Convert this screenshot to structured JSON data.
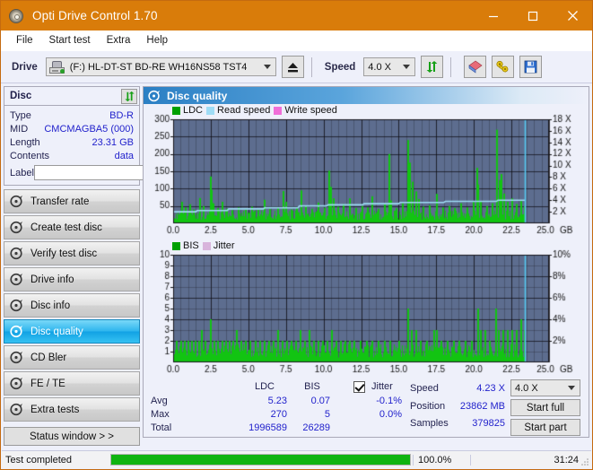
{
  "window": {
    "title": "Opti Drive Control 1.70",
    "icon": "disc-icon",
    "minimize": "–",
    "maximize": "□",
    "close": "✕"
  },
  "menu": {
    "items": [
      "File",
      "Start test",
      "Extra",
      "Help"
    ]
  },
  "toolbar": {
    "drive_label": "Drive",
    "drive_value": "(F:)  HL-DT-ST BD-RE  WH16NS58 TST4",
    "eject_icon": "eject-icon",
    "speed_label": "Speed",
    "speed_value": "4.0 X",
    "refresh_icon": "refresh-icon",
    "erase_icon": "erase-icon",
    "tools_icon": "tools-icon",
    "save_icon": "save-icon"
  },
  "disc_panel": {
    "title": "Disc",
    "refresh_icon": "refresh-icon",
    "rows": [
      {
        "key": "Type",
        "value": "BD-R"
      },
      {
        "key": "MID",
        "value": "CMCMAGBA5 (000)"
      },
      {
        "key": "Length",
        "value": "23.31 GB"
      },
      {
        "key": "Contents",
        "value": "data"
      }
    ],
    "label_key": "Label",
    "label_value": "",
    "label_placeholder": "",
    "label_button_icon": "cd-icon"
  },
  "sidebar": {
    "items": [
      {
        "label": "Transfer rate",
        "icon": "disc-icon",
        "active": false
      },
      {
        "label": "Create test disc",
        "icon": "disc-icon",
        "active": false
      },
      {
        "label": "Verify test disc",
        "icon": "disc-icon",
        "active": false
      },
      {
        "label": "Drive info",
        "icon": "disc-icon",
        "active": false
      },
      {
        "label": "Disc info",
        "icon": "disc-icon",
        "active": false
      },
      {
        "label": "Disc quality",
        "icon": "disc-icon",
        "active": true
      },
      {
        "label": "CD Bler",
        "icon": "disc-icon",
        "active": false
      },
      {
        "label": "FE / TE",
        "icon": "disc-icon",
        "active": false
      },
      {
        "label": "Extra tests",
        "icon": "disc-icon",
        "active": false
      }
    ],
    "status_window_button": "Status window > >"
  },
  "main": {
    "header": "Disc quality",
    "header_icon": "disc-icon"
  },
  "chart_data": [
    {
      "type": "line",
      "name": "top-chart",
      "title": "Disc quality - LDC / speed",
      "xlabel": "GB",
      "ylabel": "",
      "xlim": [
        0,
        25
      ],
      "ylim": [
        0,
        300
      ],
      "y2lim": [
        0,
        18
      ],
      "xticks": [
        "0.0",
        "2.5",
        "5.0",
        "7.5",
        "10.0",
        "12.5",
        "15.0",
        "17.5",
        "20.0",
        "22.5",
        "25.0"
      ],
      "yticks": [
        "50",
        "100",
        "150",
        "200",
        "250",
        "300"
      ],
      "y2ticks": [
        "2 X",
        "4 X",
        "6 X",
        "8 X",
        "10 X",
        "12 X",
        "14 X",
        "16 X",
        "18 X"
      ],
      "x_unit": "GB",
      "grid": true,
      "legend": [
        {
          "label": "LDC",
          "color": "#00a000"
        },
        {
          "label": "Read speed",
          "color": "#9fdcf5"
        },
        {
          "label": "Write speed",
          "color": "#f06fd8"
        }
      ],
      "data_end_gb": 23.4,
      "plot_bg": "#5d6d8f",
      "series": [
        {
          "name": "LDC",
          "color": "#12c412",
          "type": "impulse",
          "baseline": 22,
          "peaks": [
            {
              "x": 0.55,
              "y": 62
            },
            {
              "x": 0.8,
              "y": 46
            },
            {
              "x": 1.05,
              "y": 55
            },
            {
              "x": 1.3,
              "y": 40
            },
            {
              "x": 1.75,
              "y": 73
            },
            {
              "x": 1.95,
              "y": 50
            },
            {
              "x": 2.45,
              "y": 135
            },
            {
              "x": 2.5,
              "y": 96
            },
            {
              "x": 2.62,
              "y": 58
            },
            {
              "x": 2.9,
              "y": 44
            },
            {
              "x": 3.2,
              "y": 62
            },
            {
              "x": 3.5,
              "y": 42
            },
            {
              "x": 3.9,
              "y": 38
            },
            {
              "x": 4.3,
              "y": 46
            },
            {
              "x": 4.8,
              "y": 40
            },
            {
              "x": 5.2,
              "y": 48
            },
            {
              "x": 5.6,
              "y": 39
            },
            {
              "x": 6.0,
              "y": 68
            },
            {
              "x": 6.4,
              "y": 41
            },
            {
              "x": 6.9,
              "y": 44
            },
            {
              "x": 7.3,
              "y": 93
            },
            {
              "x": 7.45,
              "y": 62
            },
            {
              "x": 7.8,
              "y": 40
            },
            {
              "x": 8.2,
              "y": 46
            },
            {
              "x": 8.5,
              "y": 95
            },
            {
              "x": 8.8,
              "y": 52
            },
            {
              "x": 9.2,
              "y": 42
            },
            {
              "x": 9.6,
              "y": 60
            },
            {
              "x": 10.0,
              "y": 45
            },
            {
              "x": 10.3,
              "y": 152
            },
            {
              "x": 10.45,
              "y": 105
            },
            {
              "x": 10.6,
              "y": 72
            },
            {
              "x": 10.9,
              "y": 48
            },
            {
              "x": 11.3,
              "y": 56
            },
            {
              "x": 11.7,
              "y": 72
            },
            {
              "x": 12.1,
              "y": 44
            },
            {
              "x": 12.5,
              "y": 50
            },
            {
              "x": 12.9,
              "y": 46
            },
            {
              "x": 13.2,
              "y": 78
            },
            {
              "x": 13.6,
              "y": 42
            },
            {
              "x": 14.0,
              "y": 55
            },
            {
              "x": 14.3,
              "y": 200
            },
            {
              "x": 14.45,
              "y": 66
            },
            {
              "x": 14.8,
              "y": 44
            },
            {
              "x": 15.2,
              "y": 58
            },
            {
              "x": 15.6,
              "y": 240
            },
            {
              "x": 15.7,
              "y": 175
            },
            {
              "x": 15.85,
              "y": 120
            },
            {
              "x": 16.1,
              "y": 92
            },
            {
              "x": 16.3,
              "y": 70
            },
            {
              "x": 16.6,
              "y": 48
            },
            {
              "x": 17.0,
              "y": 52
            },
            {
              "x": 17.5,
              "y": 85
            },
            {
              "x": 17.9,
              "y": 46
            },
            {
              "x": 18.3,
              "y": 50
            },
            {
              "x": 18.7,
              "y": 44
            },
            {
              "x": 19.1,
              "y": 58
            },
            {
              "x": 19.5,
              "y": 46
            },
            {
              "x": 19.9,
              "y": 62
            },
            {
              "x": 20.15,
              "y": 160
            },
            {
              "x": 20.25,
              "y": 112
            },
            {
              "x": 20.4,
              "y": 64
            },
            {
              "x": 20.8,
              "y": 50
            },
            {
              "x": 21.2,
              "y": 58
            },
            {
              "x": 21.5,
              "y": 270
            },
            {
              "x": 21.65,
              "y": 125
            },
            {
              "x": 21.8,
              "y": 142
            },
            {
              "x": 21.95,
              "y": 86
            },
            {
              "x": 22.2,
              "y": 62
            },
            {
              "x": 22.5,
              "y": 72
            },
            {
              "x": 22.8,
              "y": 56
            },
            {
              "x": 23.1,
              "y": 64
            },
            {
              "x": 23.3,
              "y": 50
            }
          ]
        },
        {
          "name": "Read speed",
          "color": "#9fdcf5",
          "type": "step",
          "points": [
            {
              "x": 0.0,
              "y": 2.0
            },
            {
              "x": 1.5,
              "y": 2.0
            },
            {
              "x": 1.6,
              "y": 2.2
            },
            {
              "x": 3.6,
              "y": 2.2
            },
            {
              "x": 3.7,
              "y": 2.5
            },
            {
              "x": 6.0,
              "y": 2.5
            },
            {
              "x": 6.1,
              "y": 2.7
            },
            {
              "x": 8.3,
              "y": 2.7
            },
            {
              "x": 8.4,
              "y": 3.0
            },
            {
              "x": 10.2,
              "y": 3.0
            },
            {
              "x": 10.3,
              "y": 3.2
            },
            {
              "x": 12.6,
              "y": 3.2
            },
            {
              "x": 12.7,
              "y": 3.4
            },
            {
              "x": 15.0,
              "y": 3.4
            },
            {
              "x": 15.1,
              "y": 3.6
            },
            {
              "x": 18.0,
              "y": 3.6
            },
            {
              "x": 18.1,
              "y": 3.8
            },
            {
              "x": 21.5,
              "y": 3.8
            },
            {
              "x": 21.6,
              "y": 4.0
            },
            {
              "x": 23.4,
              "y": 4.0
            }
          ]
        },
        {
          "name": "Cursor",
          "color": "#55c8f0",
          "type": "vline",
          "x": 23.4
        }
      ]
    },
    {
      "type": "line",
      "name": "bottom-chart",
      "title": "Disc quality - BIS / jitter",
      "xlabel": "GB",
      "ylabel": "",
      "xlim": [
        0,
        25
      ],
      "ylim": [
        0,
        10
      ],
      "y2lim": [
        0,
        10
      ],
      "xticks": [
        "0.0",
        "2.5",
        "5.0",
        "7.5",
        "10.0",
        "12.5",
        "15.0",
        "17.5",
        "20.0",
        "22.5",
        "25.0"
      ],
      "yticks": [
        "1",
        "2",
        "3",
        "4",
        "5",
        "6",
        "7",
        "8",
        "9",
        "10"
      ],
      "y2ticks": [
        "2%",
        "4%",
        "6%",
        "8%",
        "10%"
      ],
      "x_unit": "GB",
      "grid": true,
      "legend": [
        {
          "label": "BIS",
          "color": "#00a000"
        },
        {
          "label": "Jitter",
          "color": "#d8b4dc"
        }
      ],
      "data_end_gb": 23.4,
      "plot_bg": "#5d6d8f",
      "series": [
        {
          "name": "BIS",
          "color": "#12c412",
          "type": "impulse",
          "baseline": 1.0,
          "peaks": [
            {
              "x": 0.2,
              "y": 2
            },
            {
              "x": 0.45,
              "y": 2
            },
            {
              "x": 0.7,
              "y": 2
            },
            {
              "x": 0.95,
              "y": 2
            },
            {
              "x": 1.2,
              "y": 2
            },
            {
              "x": 1.45,
              "y": 2
            },
            {
              "x": 1.7,
              "y": 2
            },
            {
              "x": 1.85,
              "y": 3
            },
            {
              "x": 2.1,
              "y": 2
            },
            {
              "x": 2.45,
              "y": 4
            },
            {
              "x": 2.7,
              "y": 2
            },
            {
              "x": 2.95,
              "y": 2
            },
            {
              "x": 3.2,
              "y": 2
            },
            {
              "x": 3.45,
              "y": 2
            },
            {
              "x": 3.7,
              "y": 2
            },
            {
              "x": 3.95,
              "y": 2
            },
            {
              "x": 4.2,
              "y": 3
            },
            {
              "x": 4.5,
              "y": 2
            },
            {
              "x": 4.8,
              "y": 2
            },
            {
              "x": 5.1,
              "y": 2
            },
            {
              "x": 5.4,
              "y": 2
            },
            {
              "x": 5.7,
              "y": 2
            },
            {
              "x": 6.0,
              "y": 2
            },
            {
              "x": 6.3,
              "y": 2
            },
            {
              "x": 6.6,
              "y": 2
            },
            {
              "x": 6.9,
              "y": 3
            },
            {
              "x": 7.2,
              "y": 2
            },
            {
              "x": 7.5,
              "y": 2
            },
            {
              "x": 7.8,
              "y": 2
            },
            {
              "x": 8.1,
              "y": 2
            },
            {
              "x": 8.4,
              "y": 3
            },
            {
              "x": 8.7,
              "y": 2
            },
            {
              "x": 9.0,
              "y": 3
            },
            {
              "x": 9.3,
              "y": 2
            },
            {
              "x": 9.6,
              "y": 2
            },
            {
              "x": 9.9,
              "y": 2
            },
            {
              "x": 10.2,
              "y": 2
            },
            {
              "x": 10.5,
              "y": 3
            },
            {
              "x": 10.8,
              "y": 2
            },
            {
              "x": 11.1,
              "y": 2
            },
            {
              "x": 11.4,
              "y": 2
            },
            {
              "x": 11.7,
              "y": 2
            },
            {
              "x": 12.0,
              "y": 2
            },
            {
              "x": 12.4,
              "y": 2
            },
            {
              "x": 12.8,
              "y": 2
            },
            {
              "x": 13.2,
              "y": 2
            },
            {
              "x": 13.6,
              "y": 2
            },
            {
              "x": 14.0,
              "y": 2
            },
            {
              "x": 14.4,
              "y": 2
            },
            {
              "x": 15.0,
              "y": 2
            },
            {
              "x": 15.6,
              "y": 5
            },
            {
              "x": 15.8,
              "y": 3
            },
            {
              "x": 16.1,
              "y": 3
            },
            {
              "x": 16.4,
              "y": 2
            },
            {
              "x": 16.8,
              "y": 2
            },
            {
              "x": 17.3,
              "y": 3
            },
            {
              "x": 17.5,
              "y": 3
            },
            {
              "x": 17.8,
              "y": 2
            },
            {
              "x": 18.2,
              "y": 2
            },
            {
              "x": 18.6,
              "y": 2
            },
            {
              "x": 19.0,
              "y": 2
            },
            {
              "x": 19.4,
              "y": 2
            },
            {
              "x": 19.8,
              "y": 2
            },
            {
              "x": 20.2,
              "y": 5
            },
            {
              "x": 20.4,
              "y": 3
            },
            {
              "x": 20.7,
              "y": 3
            },
            {
              "x": 21.0,
              "y": 2
            },
            {
              "x": 21.4,
              "y": 5
            },
            {
              "x": 21.6,
              "y": 3
            },
            {
              "x": 21.9,
              "y": 3
            },
            {
              "x": 22.2,
              "y": 3
            },
            {
              "x": 22.5,
              "y": 3
            },
            {
              "x": 22.8,
              "y": 3
            },
            {
              "x": 23.1,
              "y": 4
            },
            {
              "x": 23.3,
              "y": 3
            }
          ]
        },
        {
          "name": "Cursor",
          "color": "#55c8f0",
          "type": "vline",
          "x": 23.4
        }
      ]
    }
  ],
  "stats": {
    "col_ldc": "LDC",
    "col_bis": "BIS",
    "jitter_label": "Jitter",
    "jitter_checked": true,
    "rows": [
      {
        "name": "Avg",
        "ldc": "5.23",
        "bis": "0.07",
        "jitter": "-0.1%"
      },
      {
        "name": "Max",
        "ldc": "270",
        "bis": "5",
        "jitter": "0.0%"
      },
      {
        "name": "Total",
        "ldc": "1996589",
        "bis": "26289",
        "jitter": ""
      }
    ],
    "speed_label": "Speed",
    "speed_value": "4.23 X",
    "position_label": "Position",
    "position_value": "23862 MB",
    "samples_label": "Samples",
    "samples_value": "379825",
    "speed_select": "4.0 X",
    "start_full": "Start full",
    "start_part": "Start part"
  },
  "statusbar": {
    "message": "Test completed",
    "percent_text": "100.0%",
    "percent": 100,
    "elapsed": "31:24"
  }
}
